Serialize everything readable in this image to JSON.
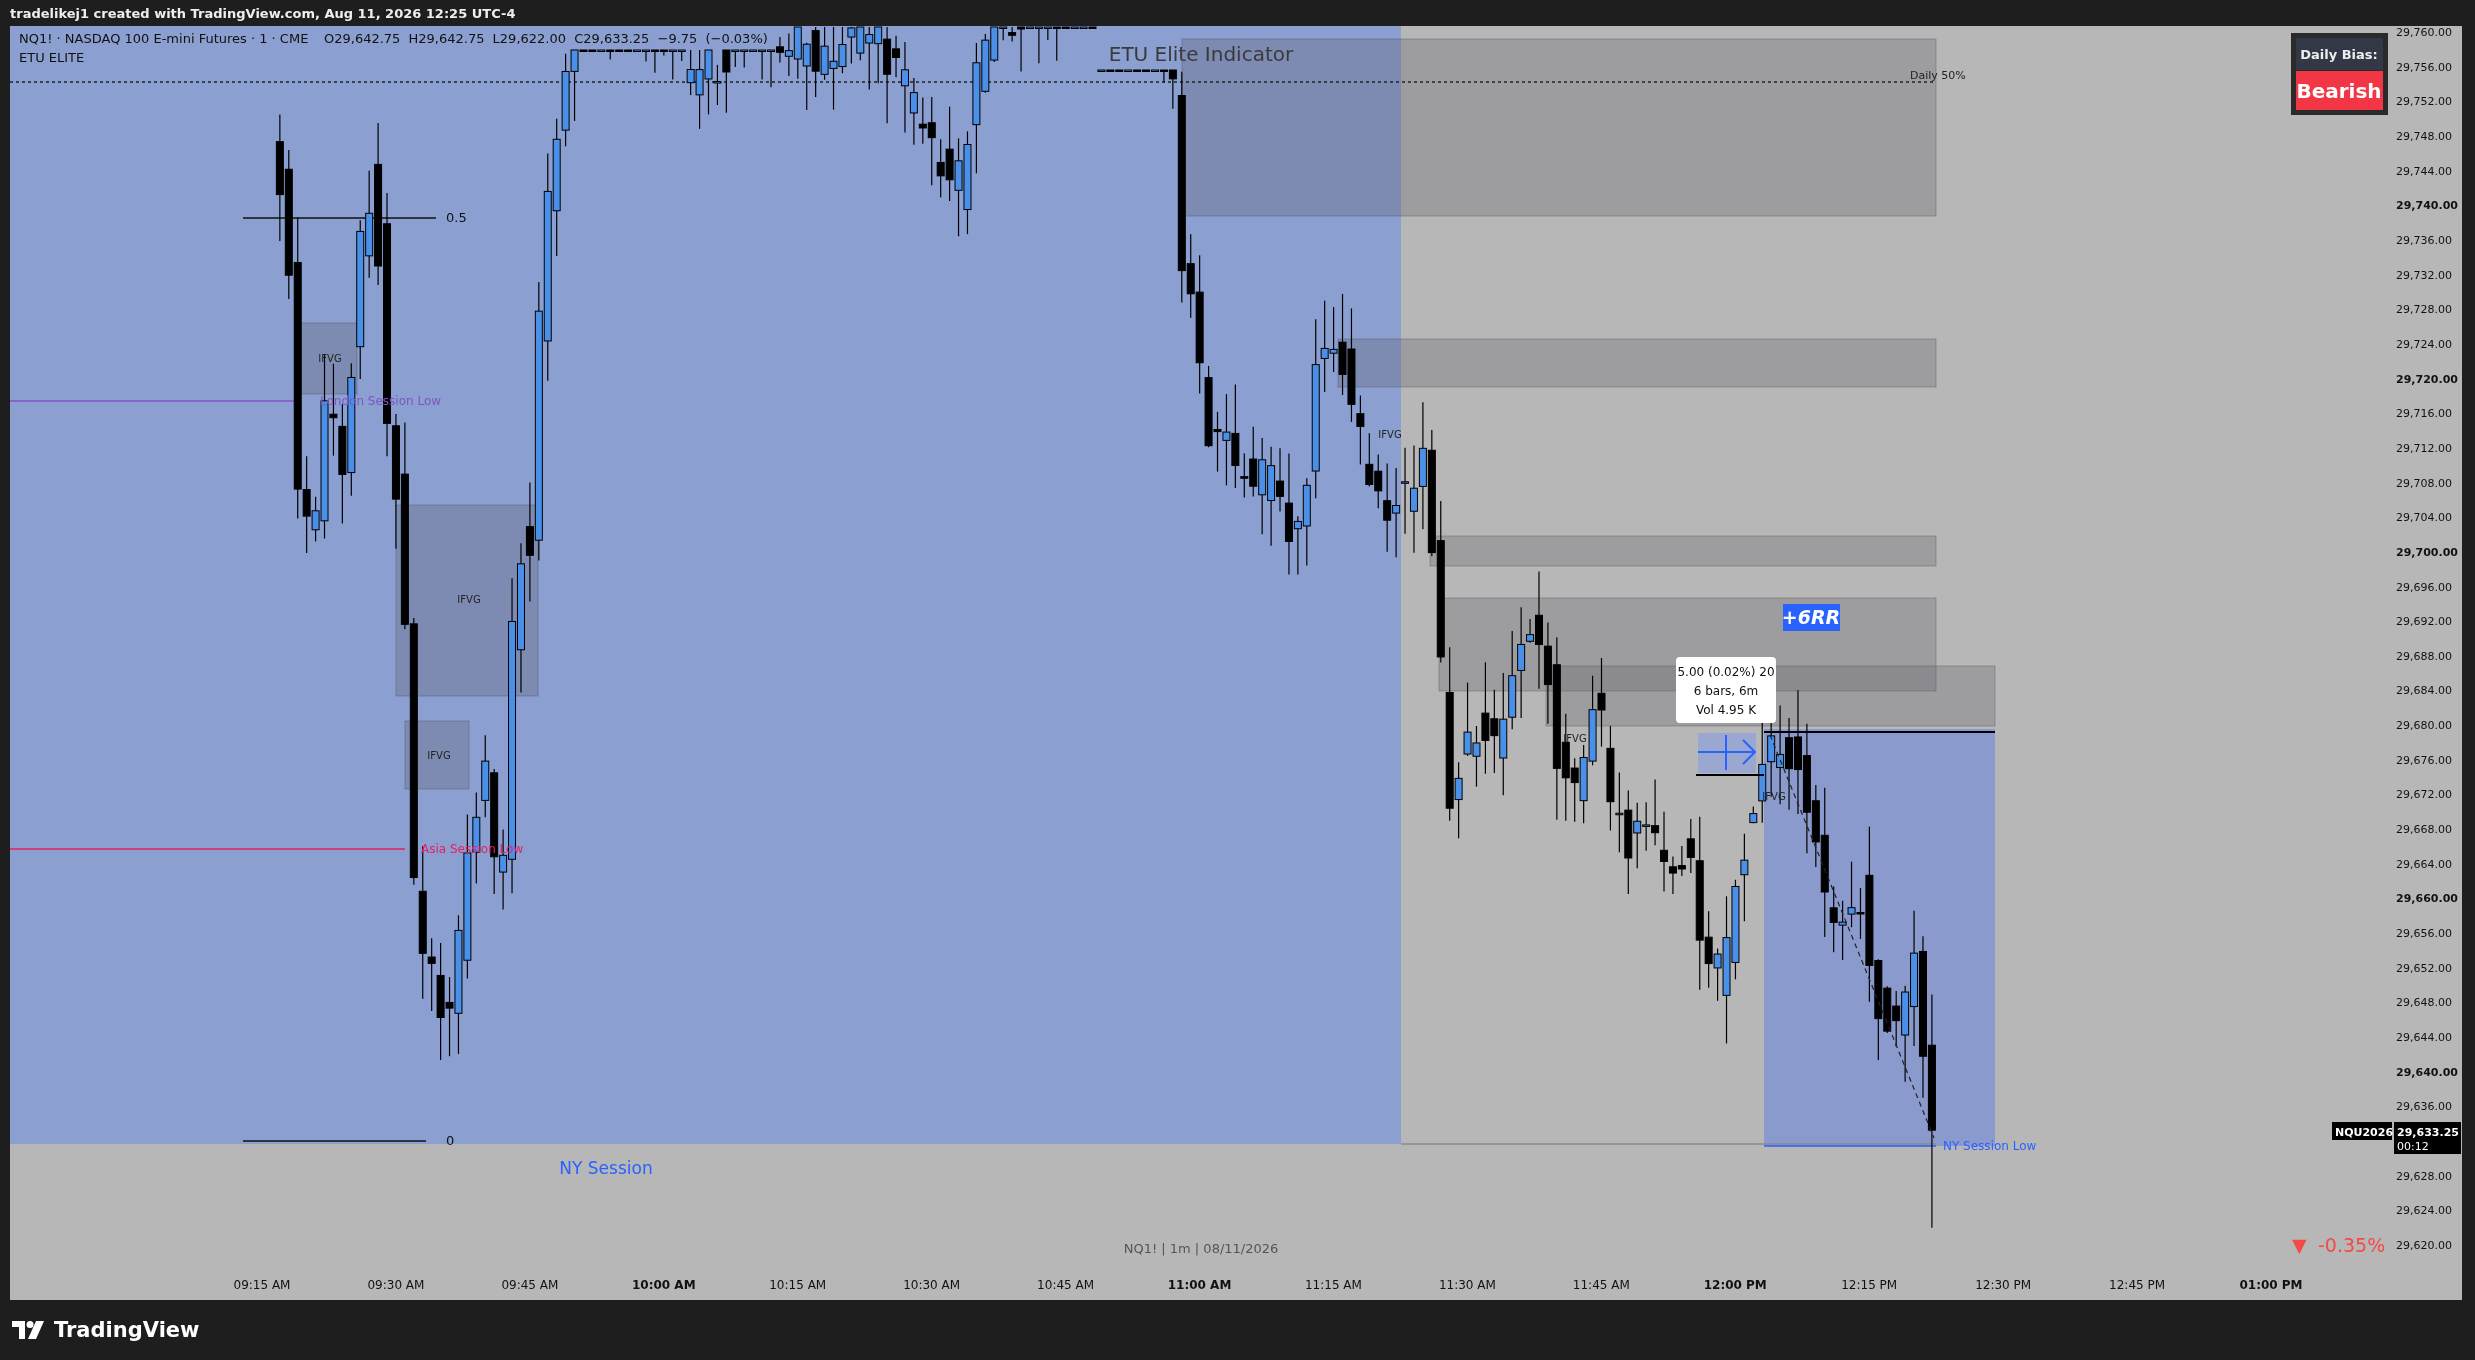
{
  "header": {
    "text": "tradelikej1 created with TradingView.com, Aug 11, 2026 12:25 UTC-4"
  },
  "legend": {
    "symbol": "NQ1! · NASDAQ 100 E-mini Futures · 1 · CME",
    "open": "O29,642.75",
    "high": "H29,642.75",
    "low": "L29,622.00",
    "close": "C29,633.25",
    "change": "−9.75 (−0.03%)",
    "indicator": "ETU ELITE"
  },
  "chart_title": "ETU Elite Indicator",
  "daily_bias": {
    "label": "Daily Bias:",
    "value": "Bearish"
  },
  "daily_50_label": "Daily 50%",
  "fib_labels": [
    "0.5",
    "0"
  ],
  "session_lows": [
    {
      "label": "London Session Low",
      "color": "#7e57c2"
    },
    {
      "label": "Asia Session Low",
      "color": "#e91e63"
    },
    {
      "label": "NY Session Low",
      "color": "#2962ff"
    }
  ],
  "fvg_labels": [
    "IFVG",
    "IFVG",
    "IFVG",
    "IFVG",
    "IFVG",
    "IFVG"
  ],
  "session_label": "NY Session",
  "rr_badge": "+6RR",
  "measure_tooltip": [
    "5.00 (0.02%) 20",
    "6 bars, 6m",
    "Vol 4.95 K"
  ],
  "symbol_info": "NQ1! | 1m | 08/11/2026",
  "change_badge": {
    "arrow": "▼",
    "text": "-0.35%"
  },
  "price_axis": [
    {
      "label": "29,760.00",
      "major": false
    },
    {
      "label": "29,756.00",
      "major": false
    },
    {
      "label": "29,752.00",
      "major": false
    },
    {
      "label": "29,748.00",
      "major": false
    },
    {
      "label": "29,744.00",
      "major": false
    },
    {
      "label": "29,740.00",
      "major": true
    },
    {
      "label": "29,736.00",
      "major": false
    },
    {
      "label": "29,732.00",
      "major": false
    },
    {
      "label": "29,728.00",
      "major": false
    },
    {
      "label": "29,724.00",
      "major": false
    },
    {
      "label": "29,720.00",
      "major": true
    },
    {
      "label": "29,716.00",
      "major": false
    },
    {
      "label": "29,712.00",
      "major": false
    },
    {
      "label": "29,708.00",
      "major": false
    },
    {
      "label": "29,704.00",
      "major": false
    },
    {
      "label": "29,700.00",
      "major": true
    },
    {
      "label": "29,696.00",
      "major": false
    },
    {
      "label": "29,692.00",
      "major": false
    },
    {
      "label": "29,688.00",
      "major": false
    },
    {
      "label": "29,684.00",
      "major": false
    },
    {
      "label": "29,680.00",
      "major": false
    },
    {
      "label": "29,676.00",
      "major": false
    },
    {
      "label": "29,672.00",
      "major": false
    },
    {
      "label": "29,668.00",
      "major": false
    },
    {
      "label": "29,664.00",
      "major": false
    },
    {
      "label": "29,660.00",
      "major": true
    },
    {
      "label": "29,656.00",
      "major": false
    },
    {
      "label": "29,652.00",
      "major": false
    },
    {
      "label": "29,648.00",
      "major": false
    },
    {
      "label": "29,644.00",
      "major": false
    },
    {
      "label": "29,640.00",
      "major": true
    },
    {
      "label": "29,636.00",
      "major": false
    },
    {
      "label": "29,628.00",
      "major": false
    },
    {
      "label": "29,624.00",
      "major": false
    },
    {
      "label": "29,620.00",
      "major": false
    }
  ],
  "last_price": {
    "symbol": "NQU2026",
    "price": "29,633.25",
    "countdown": "00:12"
  },
  "time_axis": [
    {
      "label": "09:15 AM",
      "major": false
    },
    {
      "label": "09:30 AM",
      "major": false
    },
    {
      "label": "09:45 AM",
      "major": false
    },
    {
      "label": "10:00 AM",
      "major": true
    },
    {
      "label": "10:15 AM",
      "major": false
    },
    {
      "label": "10:30 AM",
      "major": false
    },
    {
      "label": "10:45 AM",
      "major": false
    },
    {
      "label": "11:00 AM",
      "major": true
    },
    {
      "label": "11:15 AM",
      "major": false
    },
    {
      "label": "11:30 AM",
      "major": false
    },
    {
      "label": "11:45 AM",
      "major": false
    },
    {
      "label": "12:00 PM",
      "major": true
    },
    {
      "label": "12:15 PM",
      "major": false
    },
    {
      "label": "12:30 PM",
      "major": false
    },
    {
      "label": "12:45 PM",
      "major": false
    },
    {
      "label": "01:00 PM",
      "major": true
    }
  ],
  "footer": {
    "brand": "TradingView"
  }
}
